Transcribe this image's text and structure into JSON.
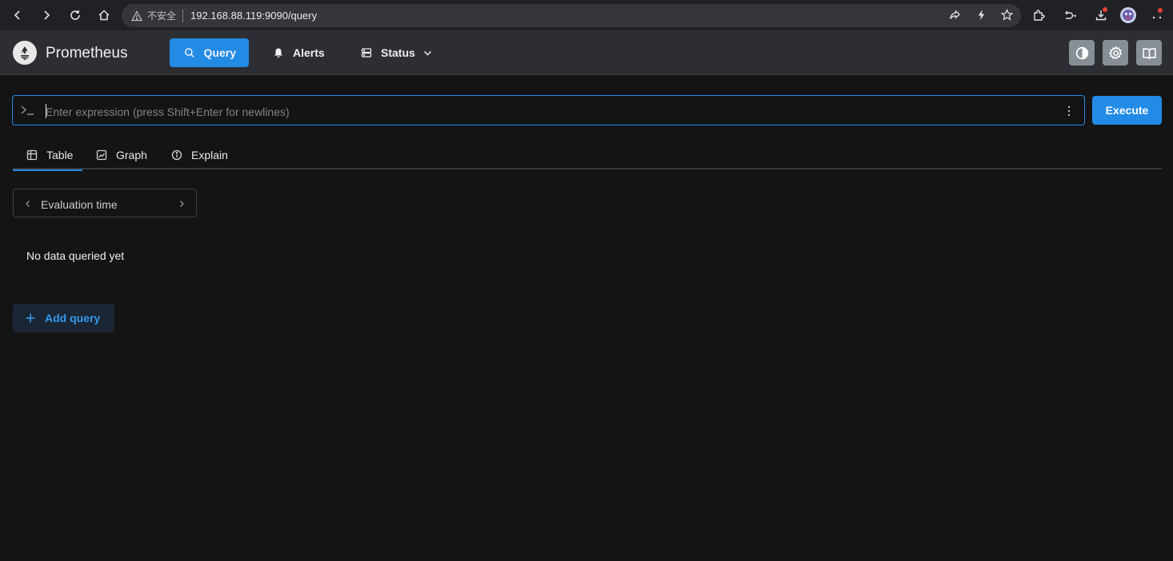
{
  "browser": {
    "insecure_label": "不安全",
    "url": "192.168.88.119:9090/query"
  },
  "app": {
    "brand": "Prometheus",
    "nav": {
      "query": "Query",
      "alerts": "Alerts",
      "status": "Status"
    }
  },
  "query": {
    "placeholder": "Enter expression (press Shift+Enter for newlines)",
    "execute_label": "Execute",
    "tabs": {
      "table": "Table",
      "graph": "Graph",
      "explain": "Explain"
    },
    "eval_time_label": "Evaluation time",
    "empty_message": "No data queried yet",
    "add_query_label": "Add query"
  },
  "colors": {
    "accent": "#228be6",
    "background": "#141414",
    "header": "#2c2e33"
  }
}
